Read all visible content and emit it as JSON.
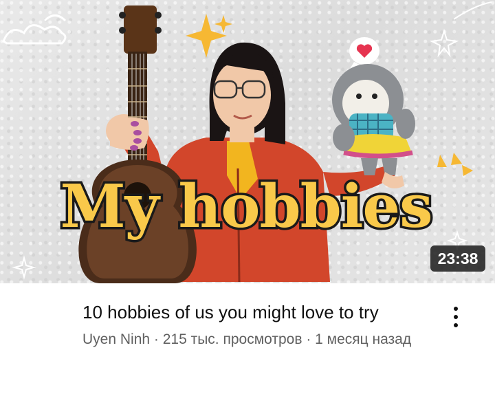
{
  "video": {
    "thumbnail_caption": "My hobbies",
    "duration": "23:38",
    "title": "10 hobbies of us you might love to try",
    "channel": "Uyen Ninh",
    "views": "215 тыс. просмотров",
    "age": "1 месяц назад",
    "subtitle_full": "Uyen Ninh · 215 тыс. просмотров · 1 месяц назад"
  },
  "icons": {
    "more": "more-vertical-icon",
    "sparkle": "sparkle-icon",
    "heart": "heart-icon",
    "cloud": "cloud-icon"
  },
  "colors": {
    "caption_fill": "#f9c94a",
    "caption_outline": "#1a1a1a",
    "cardigan": "#d2462b",
    "shirt": "#f2b51f",
    "accent_yellow": "#f6b833",
    "heart": "#e63450"
  }
}
